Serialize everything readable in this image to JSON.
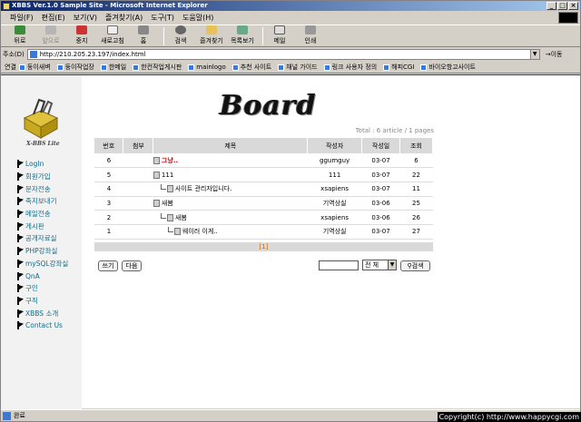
{
  "window": {
    "title": "XBBS Ver.1.0 Sample Site - Microsoft Internet Explorer",
    "controls": [
      "_",
      "□",
      "×"
    ]
  },
  "menu": [
    "파일(F)",
    "편집(E)",
    "보기(V)",
    "즐겨찾기(A)",
    "도구(T)",
    "도움말(H)"
  ],
  "toolbar": {
    "back": "뒤로",
    "forward": "앞으로",
    "stop": "중지",
    "refresh": "새로고침",
    "home": "홈",
    "search": "검색",
    "favorites": "즐겨찾기",
    "history": "목록보기",
    "mail": "메일",
    "print": "인쇄"
  },
  "address": {
    "label": "주소(D)",
    "url": "http://210.205.23.197/index.html",
    "go": "이동"
  },
  "links": {
    "label": "연결",
    "items": [
      "둥이새벼",
      "둥이작업장",
      "한메일",
      "한컨작업게시판",
      "mainlogo",
      "추천 사이트",
      "채널 가이드",
      "링크 사용자 정의",
      "해피CGI",
      "바이오항고사이트"
    ]
  },
  "sidebar": {
    "logo_text": "X-BBS Lite",
    "items": [
      "LogIn",
      "회원가입",
      "문자전송",
      "족지보내기",
      "메일전송",
      "게시판",
      "공개자료실",
      "PHP강좌실",
      "mySQL강좌실",
      "QnA",
      "구인",
      "구직",
      "XBBS 소개",
      "Contact Us"
    ]
  },
  "board": {
    "title": "Board",
    "total": "Total : 6 article / 1 pages",
    "headers": [
      "번호",
      "첨부",
      "제목",
      "작성자",
      "작성일",
      "조회"
    ],
    "rows": [
      {
        "no": "6",
        "subject": "그냥..",
        "author": "ggumguy",
        "date": "03-07",
        "views": "6"
      },
      {
        "no": "5",
        "subject": "111",
        "author": "111",
        "date": "03-07",
        "views": "22"
      },
      {
        "no": "4",
        "subject": "사이트 관리자입니다.",
        "author": "xsapiens",
        "date": "03-07",
        "views": "11"
      },
      {
        "no": "3",
        "subject": "새봄",
        "author": "기역상실",
        "date": "03-06",
        "views": "25"
      },
      {
        "no": "2",
        "subject": "새봄",
        "author": "xsapiens",
        "date": "03-06",
        "views": "26"
      },
      {
        "no": "1",
        "subject": "웨이러 이게..",
        "author": "기역상실",
        "date": "03-07",
        "views": "27"
      }
    ],
    "pager": "[1]",
    "write_button": "쓰기",
    "next_button": "다음",
    "search_scope": "전 체",
    "search_button": "검색"
  },
  "status": {
    "text": "완료",
    "copyright": "Copyright(c) http://www.happycgi.com"
  }
}
